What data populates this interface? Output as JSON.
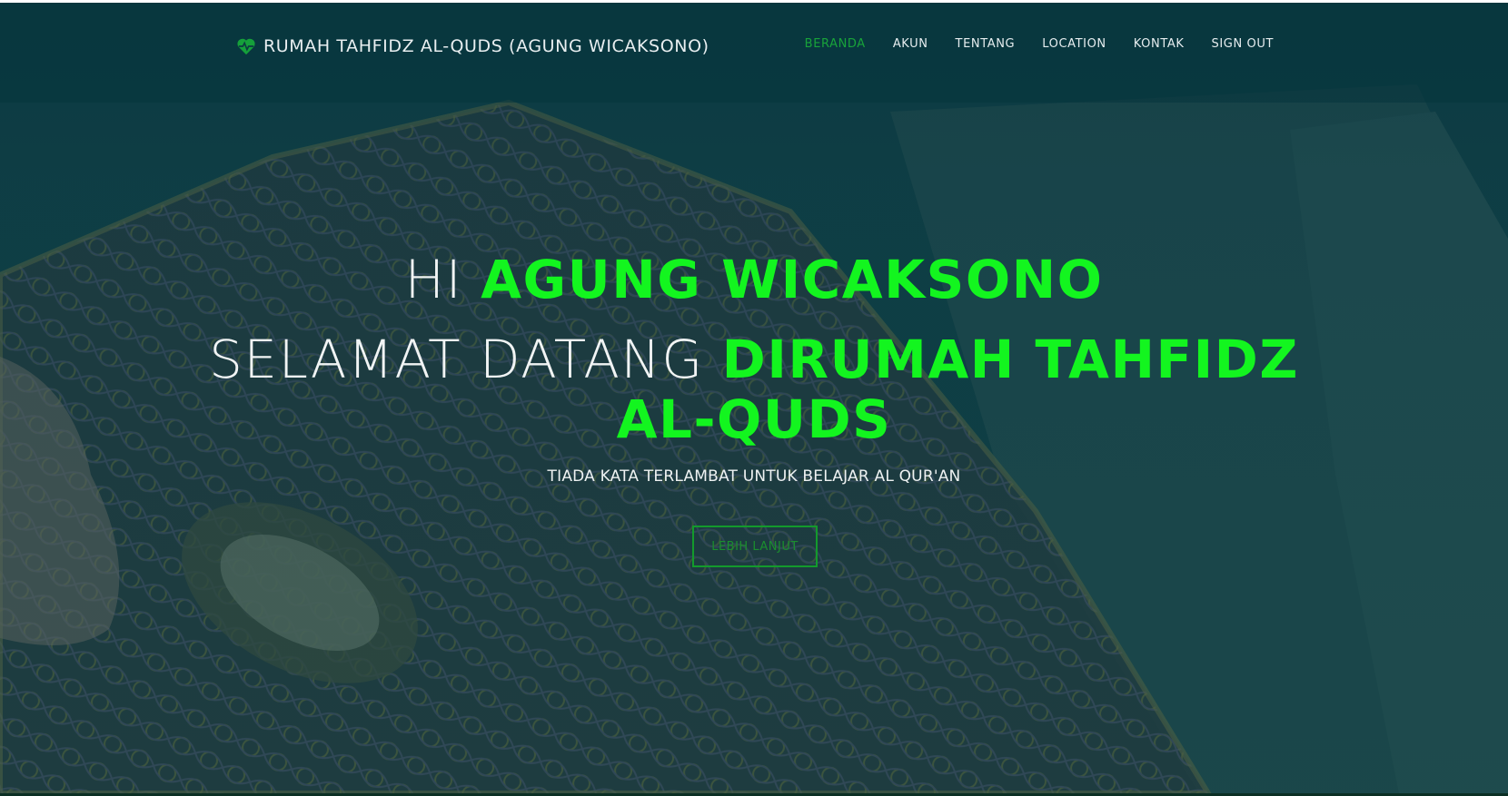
{
  "brand": {
    "icon": "heartbeat-icon",
    "title": "RUMAH TAHFIDZ AL-QUDS (AGUNG WICAKSONO)"
  },
  "nav": {
    "items": [
      {
        "label": "BERANDA",
        "active": true
      },
      {
        "label": "AKUN",
        "active": false
      },
      {
        "label": "TENTANG",
        "active": false
      },
      {
        "label": "LOCATION",
        "active": false
      },
      {
        "label": "KONTAK",
        "active": false
      },
      {
        "label": "SIGN OUT",
        "active": false
      }
    ]
  },
  "hero": {
    "greeting_prefix": "HI ",
    "greeting_name": "AGUNG WICAKSONO",
    "welcome_prefix": "SELAMAT DATANG ",
    "welcome_highlight_1": "DIRUMAH TAHFIDZ",
    "welcome_highlight_2": "AL-QUDS",
    "tagline": "TIADA KATA TERLAMBAT UNTUK BELAJAR AL QUR'AN",
    "cta_label": "LEBIH LANJUT",
    "background": "quran-book-photo"
  },
  "colors": {
    "accent": "#13f51f",
    "nav_active": "#18a33a",
    "overlay": "#0d3a40"
  }
}
